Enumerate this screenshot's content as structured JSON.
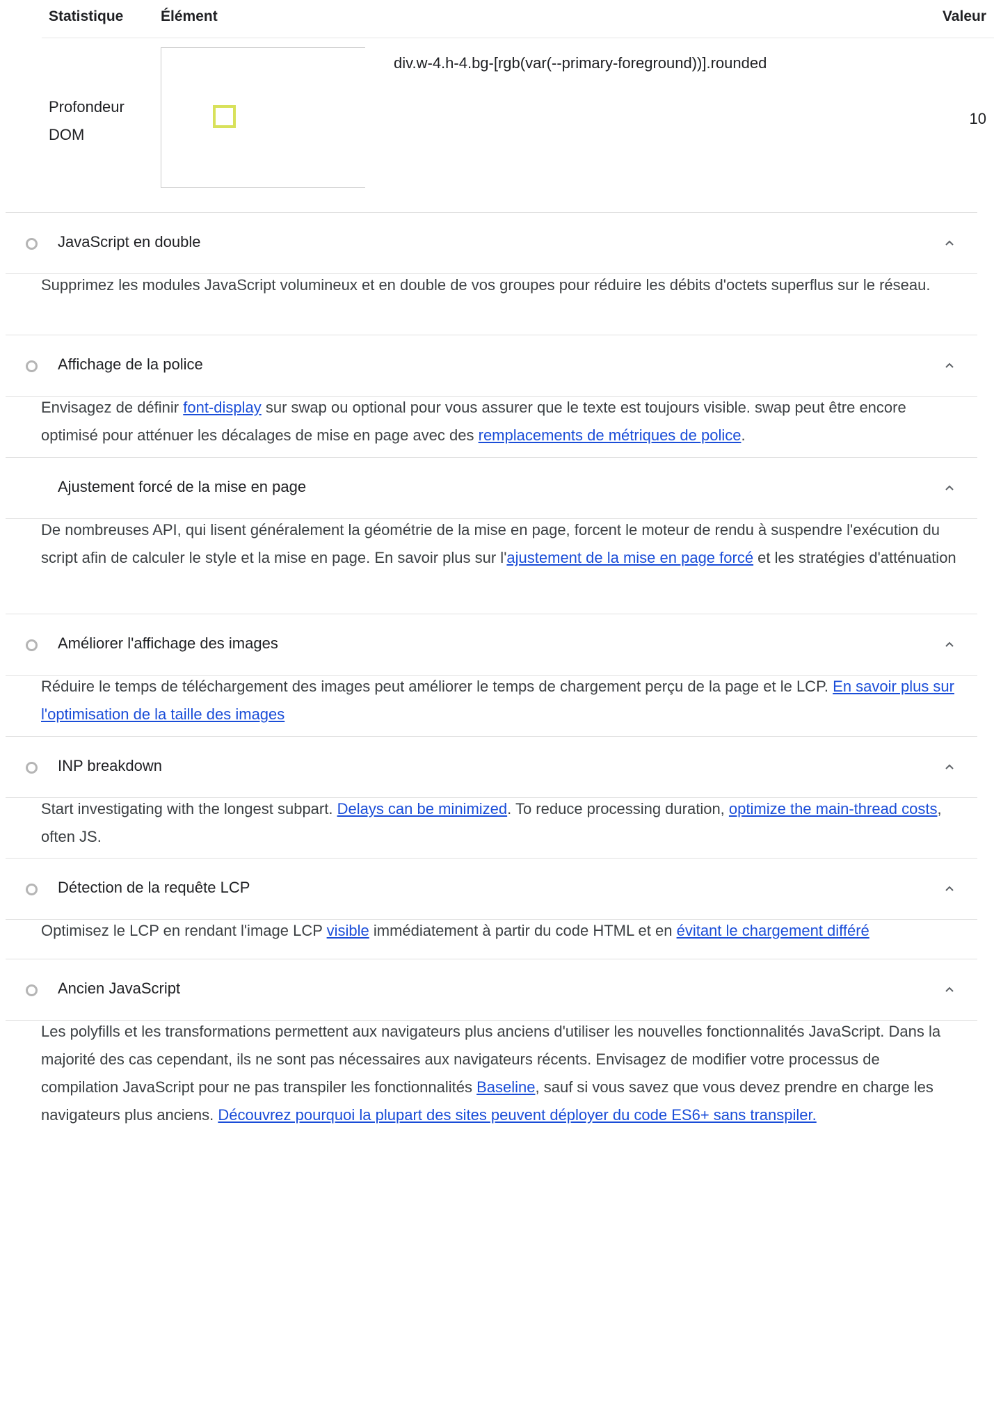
{
  "table": {
    "col_stat": "Statistique",
    "col_element": "Élément",
    "col_value": "Valeur",
    "row": {
      "stat_line1": "Profondeur",
      "stat_line2": "DOM",
      "selector": "div.w-4.h-4.bg-[rgb(var(--primary-foreground))].rounded",
      "value": "10"
    }
  },
  "audits": [
    {
      "title": "JavaScript en double",
      "has_status": true,
      "parts": [
        {
          "t": "Supprimez les modules JavaScript volumineux et en double de vos groupes pour réduire les débits d'octets superflus sur le réseau."
        }
      ]
    },
    {
      "title": "Affichage de la police",
      "has_status": true,
      "parts": [
        {
          "t": "Envisagez de définir "
        },
        {
          "t": "font-display",
          "link": true
        },
        {
          "t": " sur swap ou optional pour vous assurer que le texte est toujours visible. swap peut être encore optimisé pour atténuer les décalages de mise en page avec des "
        },
        {
          "t": "remplacements de métriques de police",
          "link": true
        },
        {
          "t": "."
        }
      ]
    },
    {
      "title": "Ajustement forcé de la mise en page",
      "has_status": false,
      "parts": [
        {
          "t": "De nombreuses API, qui lisent généralement la géométrie de la mise en page, forcent le moteur de rendu à suspendre l'exécution du script afin de calculer le style et la mise en page. En savoir plus sur l'"
        },
        {
          "t": "ajustement de la mise en page forcé",
          "link": true
        },
        {
          "t": " et les stratégies d'atténuation"
        }
      ]
    },
    {
      "title": "Améliorer l'affichage des images",
      "has_status": true,
      "parts": [
        {
          "t": "Réduire le temps de téléchargement des images peut améliorer le temps de chargement perçu de la page et le LCP. "
        },
        {
          "t": "En savoir plus sur l'optimisation de la taille des images",
          "link": true
        }
      ]
    },
    {
      "title": "INP breakdown",
      "has_status": true,
      "parts": [
        {
          "t": "Start investigating with the longest subpart. "
        },
        {
          "t": "Delays can be minimized",
          "link": true
        },
        {
          "t": ". To reduce processing duration, "
        },
        {
          "t": "optimize the main-thread costs",
          "link": true
        },
        {
          "t": ", often JS."
        }
      ]
    },
    {
      "title": "Détection de la requête LCP",
      "has_status": true,
      "parts": [
        {
          "t": "Optimisez le LCP en rendant l'image LCP "
        },
        {
          "t": "visible",
          "link": true
        },
        {
          "t": " immédiatement à partir du code HTML et en "
        },
        {
          "t": "évitant le chargement différé",
          "link": true
        }
      ]
    },
    {
      "title": "Ancien JavaScript",
      "has_status": true,
      "parts": [
        {
          "t": "Les polyfills et les transformations permettent aux navigateurs plus anciens d'utiliser les nouvelles fonctionnalités JavaScript. Dans la majorité des cas cependant, ils ne sont pas nécessaires aux navigateurs récents. Envisagez de modifier votre processus de compilation JavaScript pour ne pas transpiler les fonctionnalités "
        },
        {
          "t": "Baseline",
          "link": true
        },
        {
          "t": ", sauf si vous savez que vous devez prendre en charge les navigateurs plus anciens. "
        },
        {
          "t": "Découvrez pourquoi la plupart des sites peuvent déployer du code ES6+ sans transpiler.",
          "link": true
        }
      ]
    }
  ],
  "icons": {
    "status": "status-circle-icon",
    "toggle": "chevron-up-icon"
  },
  "colors": {
    "link": "#1a4dd8",
    "status_circle": "#b5b5b5",
    "thumbnail_square": "#d8e15b"
  }
}
